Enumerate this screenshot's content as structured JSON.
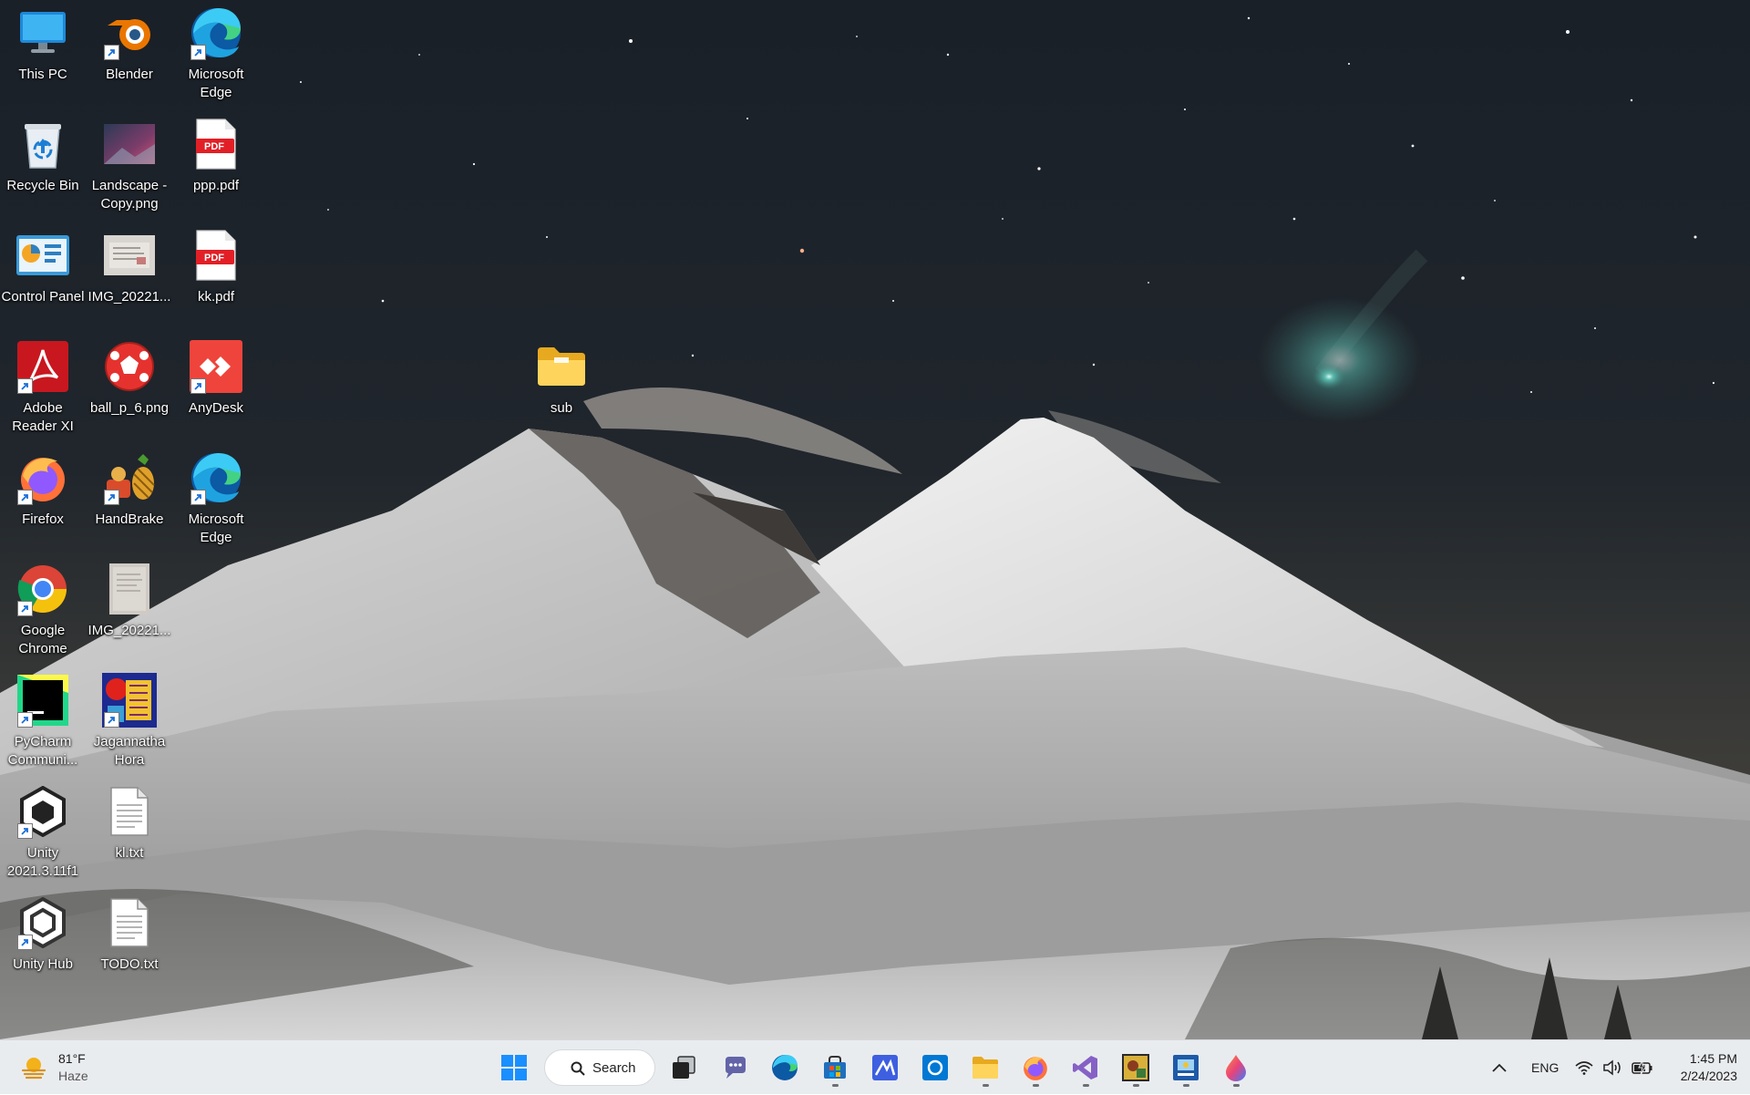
{
  "desktop": {
    "icons": [
      {
        "label": "This PC",
        "icon": "this-pc-icon",
        "shortcut": false
      },
      {
        "label": "Recycle Bin",
        "icon": "recycle-bin-icon",
        "shortcut": false
      },
      {
        "label": "Control Panel",
        "icon": "control-panel-icon",
        "shortcut": false
      },
      {
        "label": "Adobe\nReader XI",
        "icon": "adobe-reader-icon",
        "shortcut": true
      },
      {
        "label": "Firefox",
        "icon": "firefox-icon",
        "shortcut": true
      },
      {
        "label": "Google\nChrome",
        "icon": "chrome-icon",
        "shortcut": true
      },
      {
        "label": "PyCharm\nCommuni...",
        "icon": "pycharm-icon",
        "shortcut": true
      },
      {
        "label": "Unity\n2021.3.11f1",
        "icon": "unity-icon",
        "shortcut": true
      },
      {
        "label": "Unity Hub",
        "icon": "unity-hub-icon",
        "shortcut": true
      },
      {
        "label": "Blender",
        "icon": "blender-icon",
        "shortcut": true
      },
      {
        "label": "Landscape -\nCopy.png",
        "icon": "image-file-icon",
        "shortcut": false
      },
      {
        "label": "IMG_20221...",
        "icon": "image-file-icon",
        "shortcut": false
      },
      {
        "label": "ball_p_6.png",
        "icon": "ball-image-icon",
        "shortcut": false
      },
      {
        "label": "HandBrake",
        "icon": "handbrake-icon",
        "shortcut": true
      },
      {
        "label": "IMG_20221...",
        "icon": "image-file-icon",
        "shortcut": false
      },
      {
        "label": "Jagannatha\nHora",
        "icon": "jagannatha-hora-icon",
        "shortcut": true
      },
      {
        "label": "kl.txt",
        "icon": "text-file-icon",
        "shortcut": false
      },
      {
        "label": "TODO.txt",
        "icon": "text-file-icon",
        "shortcut": false
      },
      {
        "label": "Microsoft\nEdge",
        "icon": "edge-icon",
        "shortcut": true
      },
      {
        "label": "ppp.pdf",
        "icon": "pdf-file-icon",
        "shortcut": false
      },
      {
        "label": "kk.pdf",
        "icon": "pdf-file-icon",
        "shortcut": false
      },
      {
        "label": "AnyDesk",
        "icon": "anydesk-icon",
        "shortcut": true
      },
      {
        "label": "Microsoft\nEdge",
        "icon": "edge-icon",
        "shortcut": true
      },
      {
        "label": "sub",
        "icon": "folder-icon",
        "shortcut": false
      }
    ]
  },
  "taskbar": {
    "weather": {
      "temp": "81°F",
      "condition": "Haze",
      "icon": "haze-weather-icon"
    },
    "start_icon": "windows-start-icon",
    "search_label": "Search",
    "apps": [
      {
        "name": "task-view",
        "icon": "task-view-icon",
        "running": false
      },
      {
        "name": "chat",
        "icon": "teams-chat-icon",
        "running": false
      },
      {
        "name": "edge",
        "icon": "edge-icon",
        "running": false
      },
      {
        "name": "store",
        "icon": "microsoft-store-icon",
        "running": true
      },
      {
        "name": "math",
        "icon": "math-app-icon",
        "running": false
      },
      {
        "name": "remote",
        "icon": "remote-app-icon",
        "running": false
      },
      {
        "name": "file-explorer",
        "icon": "file-explorer-icon",
        "running": true
      },
      {
        "name": "firefox",
        "icon": "firefox-icon",
        "running": true
      },
      {
        "name": "visual-studio",
        "icon": "visual-studio-icon",
        "running": true
      },
      {
        "name": "app-gold",
        "icon": "gold-app-icon",
        "running": true
      },
      {
        "name": "app-blue",
        "icon": "blue-app-icon",
        "running": true
      },
      {
        "name": "paint",
        "icon": "paint-drop-icon",
        "running": true
      }
    ],
    "tray": {
      "language": "ENG",
      "time": "1:45 PM",
      "date": "2/24/2023"
    }
  },
  "colors": {
    "taskbar_bg": "#e9ecef",
    "accent": "#0067c0"
  }
}
